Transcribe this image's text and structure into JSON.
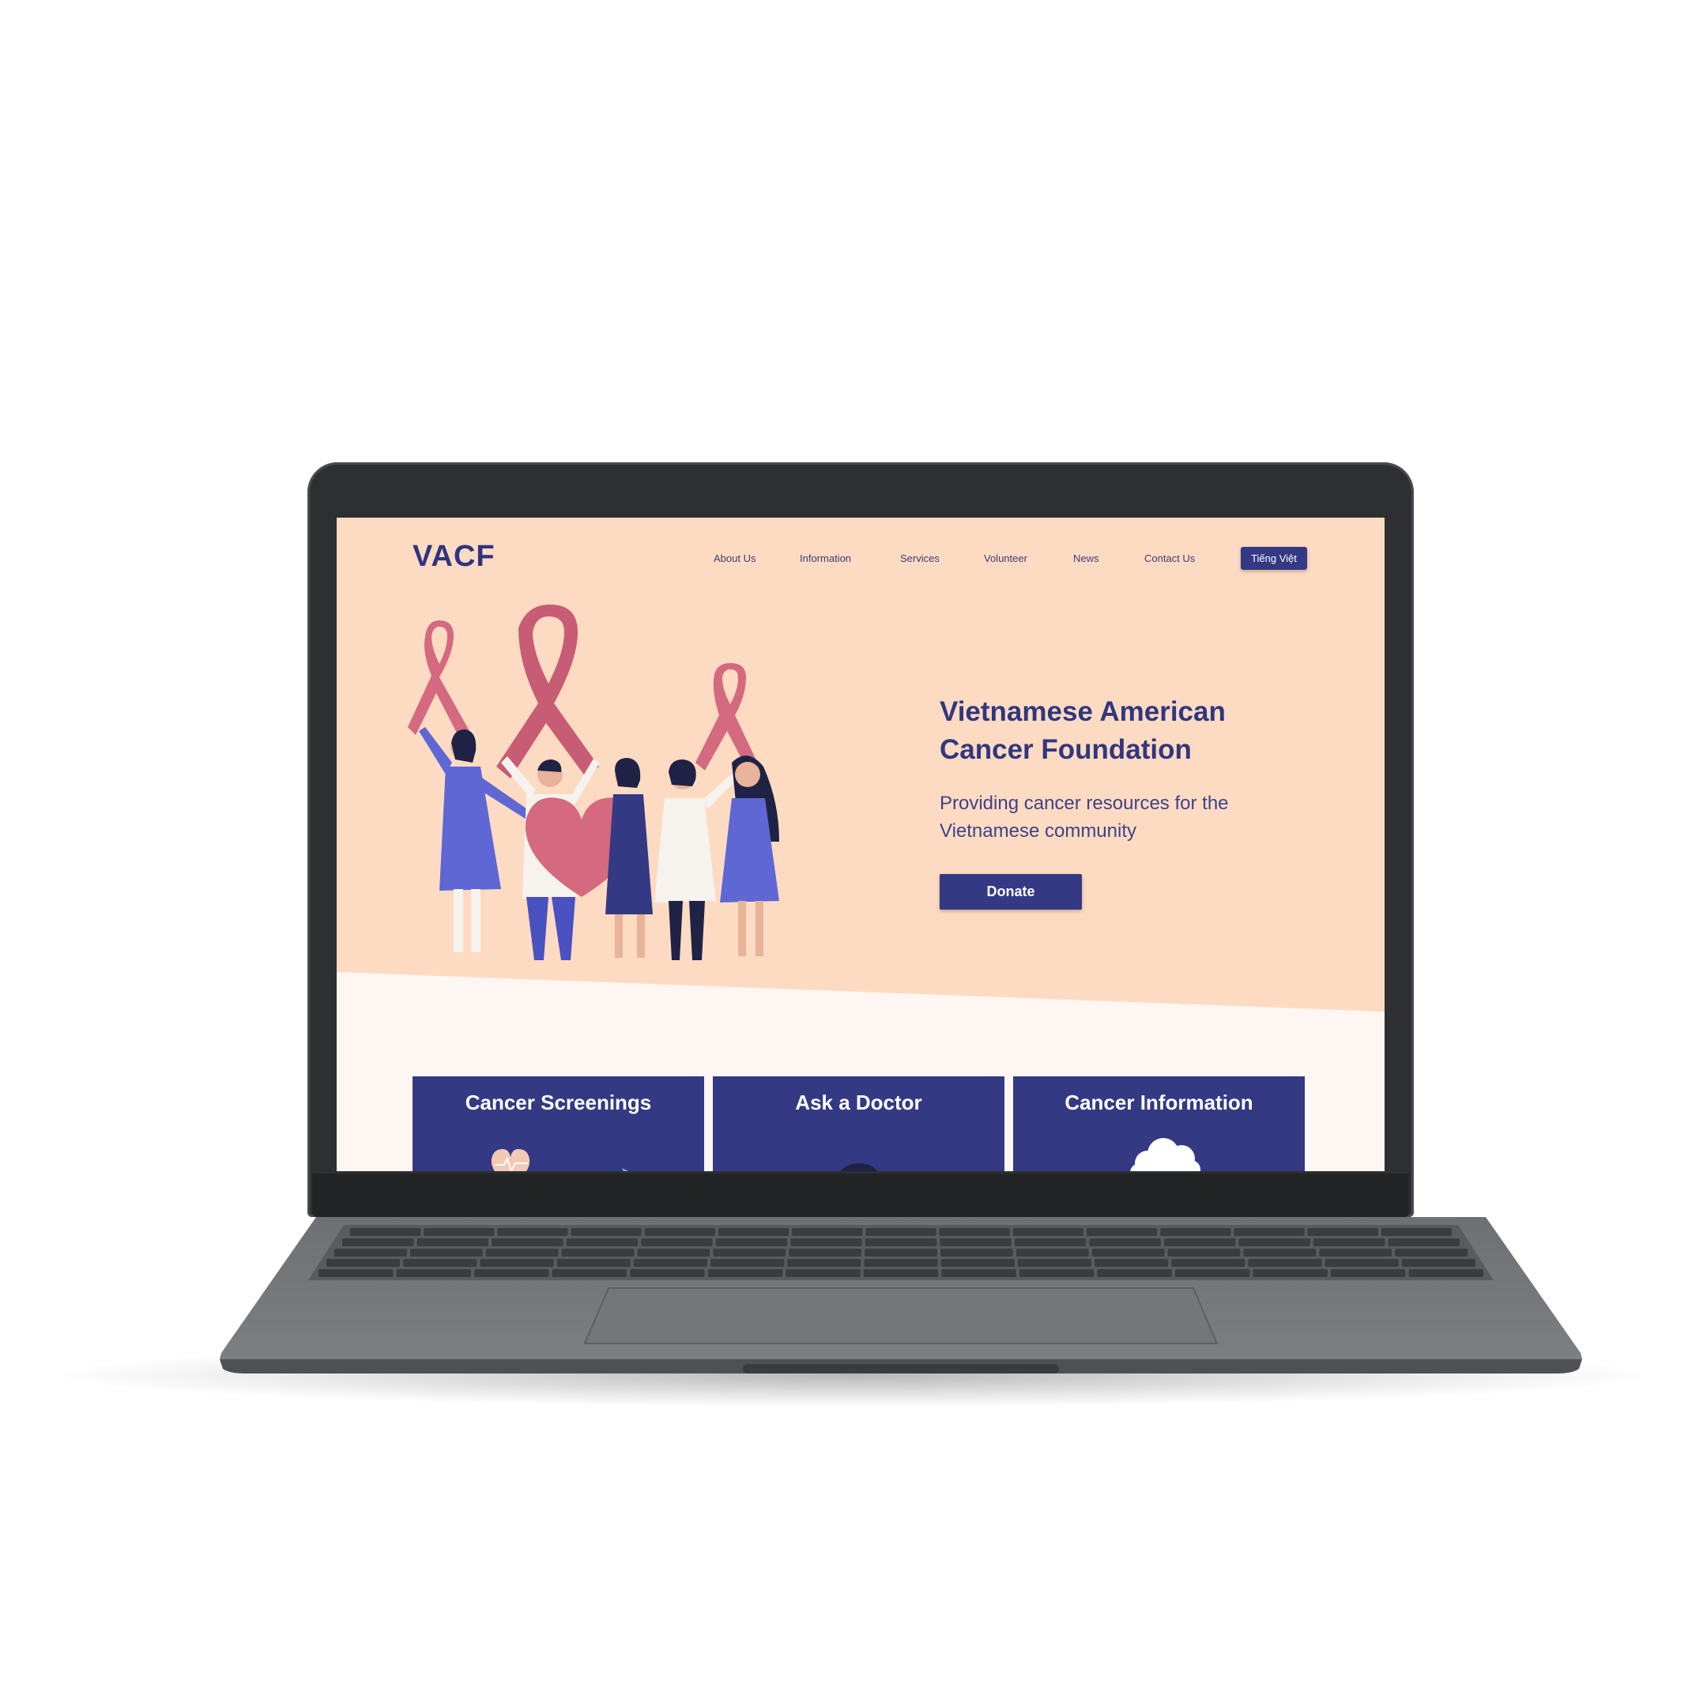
{
  "site": {
    "logo": "VACF",
    "nav": [
      "About Us",
      "Information",
      "Services",
      "Volunteer",
      "News",
      "Contact Us"
    ],
    "language_button": "Tiếng Việt"
  },
  "hero": {
    "title_line1": "Vietnamese American",
    "title_line2": "Cancer Foundation",
    "subtitle_line1": "Providing cancer resources for the",
    "subtitle_line2": "Vietnamese community",
    "donate_label": "Donate"
  },
  "cards": [
    {
      "title": "Cancer Screenings",
      "icon": "heart-monitor-icon"
    },
    {
      "title": "Ask a Doctor",
      "icon": "doctor-icon"
    },
    {
      "title": "Cancer Information",
      "icon": "cloud-icon"
    }
  ],
  "colors": {
    "brand_navy": "#343984",
    "hero_background": "#fddbc2",
    "ribbon_pink": "#d4697f",
    "laptop_body": "#2e2f31"
  }
}
